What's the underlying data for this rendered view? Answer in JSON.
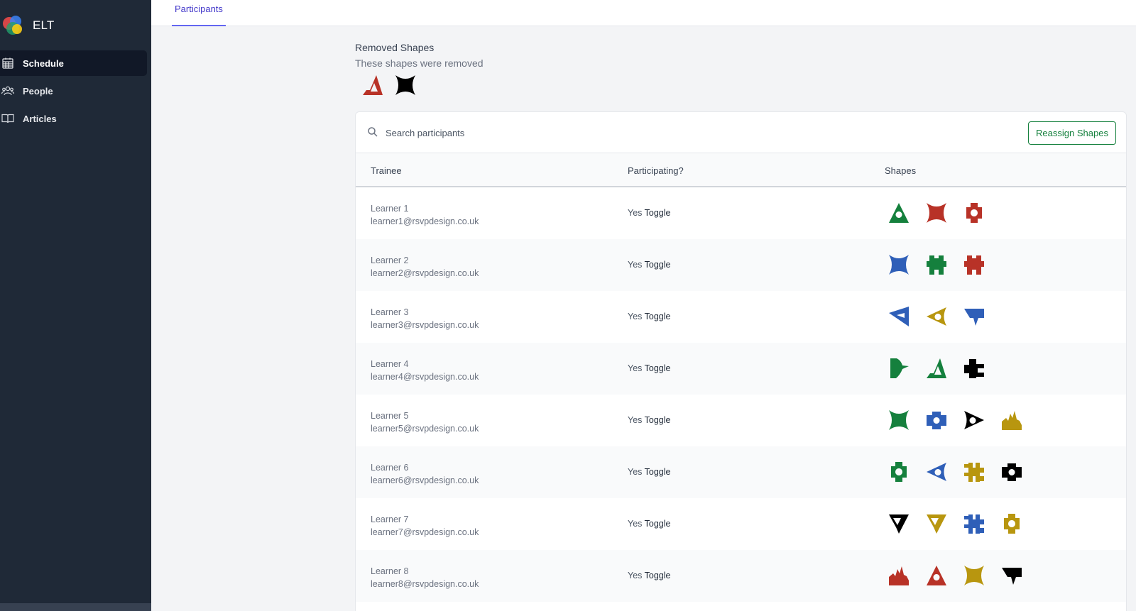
{
  "app": {
    "name": "ELT",
    "logo_colors": [
      "#e04848",
      "#3b82f6",
      "#22a06b",
      "#facc15"
    ]
  },
  "sidebar": {
    "items": [
      {
        "label": "Schedule",
        "icon": "calendar-icon",
        "active": true
      },
      {
        "label": "People",
        "icon": "users-icon",
        "active": false
      },
      {
        "label": "Articles",
        "icon": "book-icon",
        "active": false
      }
    ]
  },
  "topbar": {
    "tabs": [
      {
        "label": "Participants",
        "active": true
      }
    ]
  },
  "removed": {
    "title": "Removed Shapes",
    "subtitle": "These shapes were removed",
    "shapes": [
      {
        "icon": "delta-shape",
        "color": "#b83227"
      },
      {
        "icon": "bowtie-shape",
        "color": "#000000"
      }
    ]
  },
  "search": {
    "placeholder": "Search participants"
  },
  "reassign_label": "Reassign Shapes",
  "table": {
    "headers": [
      "Trainee",
      "Participating?",
      "Shapes"
    ],
    "toggle_label": "Toggle",
    "rows": [
      {
        "name": "Learner 1",
        "email": "learner1@rsvpdesign.co.uk",
        "participating": "Yes",
        "shapes": [
          {
            "icon": "triangle-hole-shape",
            "color": "#15803d"
          },
          {
            "icon": "bowtie-shape",
            "color": "#b83227"
          },
          {
            "icon": "plus-hole-shape",
            "color": "#b83227"
          }
        ]
      },
      {
        "name": "Learner 2",
        "email": "learner2@rsvpdesign.co.uk",
        "participating": "Yes",
        "shapes": [
          {
            "icon": "bowtie-shape",
            "color": "#2f5fb8"
          },
          {
            "icon": "notch-block-shape",
            "color": "#15803d"
          },
          {
            "icon": "notch-block-shape",
            "color": "#b83227"
          }
        ]
      },
      {
        "name": "Learner 3",
        "email": "learner3@rsvpdesign.co.uk",
        "participating": "Yes",
        "shapes": [
          {
            "icon": "arrow-left-shape",
            "color": "#2f5fb8"
          },
          {
            "icon": "eye-left-shape",
            "color": "#b8960f"
          },
          {
            "icon": "shield-shape",
            "color": "#2f5fb8"
          }
        ]
      },
      {
        "name": "Learner 4",
        "email": "learner4@rsvpdesign.co.uk",
        "participating": "Yes",
        "shapes": [
          {
            "icon": "flag-shape",
            "color": "#15803d"
          },
          {
            "icon": "delta-shape",
            "color": "#15803d"
          },
          {
            "icon": "cross-bolt-shape",
            "color": "#000000"
          }
        ]
      },
      {
        "name": "Learner 5",
        "email": "learner5@rsvpdesign.co.uk",
        "participating": "Yes",
        "shapes": [
          {
            "icon": "bowtie-shape",
            "color": "#15803d"
          },
          {
            "icon": "gear-shape",
            "color": "#2f5fb8"
          },
          {
            "icon": "eye-right-shape",
            "color": "#000000"
          },
          {
            "icon": "crown-shape",
            "color": "#b8960f"
          }
        ]
      },
      {
        "name": "Learner 6",
        "email": "learner6@rsvpdesign.co.uk",
        "participating": "Yes",
        "shapes": [
          {
            "icon": "plus-hole-shape",
            "color": "#15803d"
          },
          {
            "icon": "eye-left-shape",
            "color": "#2f5fb8"
          },
          {
            "icon": "hash-shape",
            "color": "#b8960f"
          },
          {
            "icon": "gear-shape",
            "color": "#000000"
          }
        ]
      },
      {
        "name": "Learner 7",
        "email": "learner7@rsvpdesign.co.uk",
        "participating": "Yes",
        "shapes": [
          {
            "icon": "funnel-shape",
            "color": "#000000"
          },
          {
            "icon": "funnel-shape",
            "color": "#b8960f"
          },
          {
            "icon": "hash-shape",
            "color": "#2f5fb8"
          },
          {
            "icon": "plus-hole-shape",
            "color": "#b8960f"
          }
        ]
      },
      {
        "name": "Learner 8",
        "email": "learner8@rsvpdesign.co.uk",
        "participating": "Yes",
        "shapes": [
          {
            "icon": "crown-shape",
            "color": "#b83227"
          },
          {
            "icon": "triangle-hole-shape",
            "color": "#b83227"
          },
          {
            "icon": "bowtie-shape",
            "color": "#b8960f"
          },
          {
            "icon": "shield-shape",
            "color": "#000000"
          }
        ]
      }
    ]
  }
}
